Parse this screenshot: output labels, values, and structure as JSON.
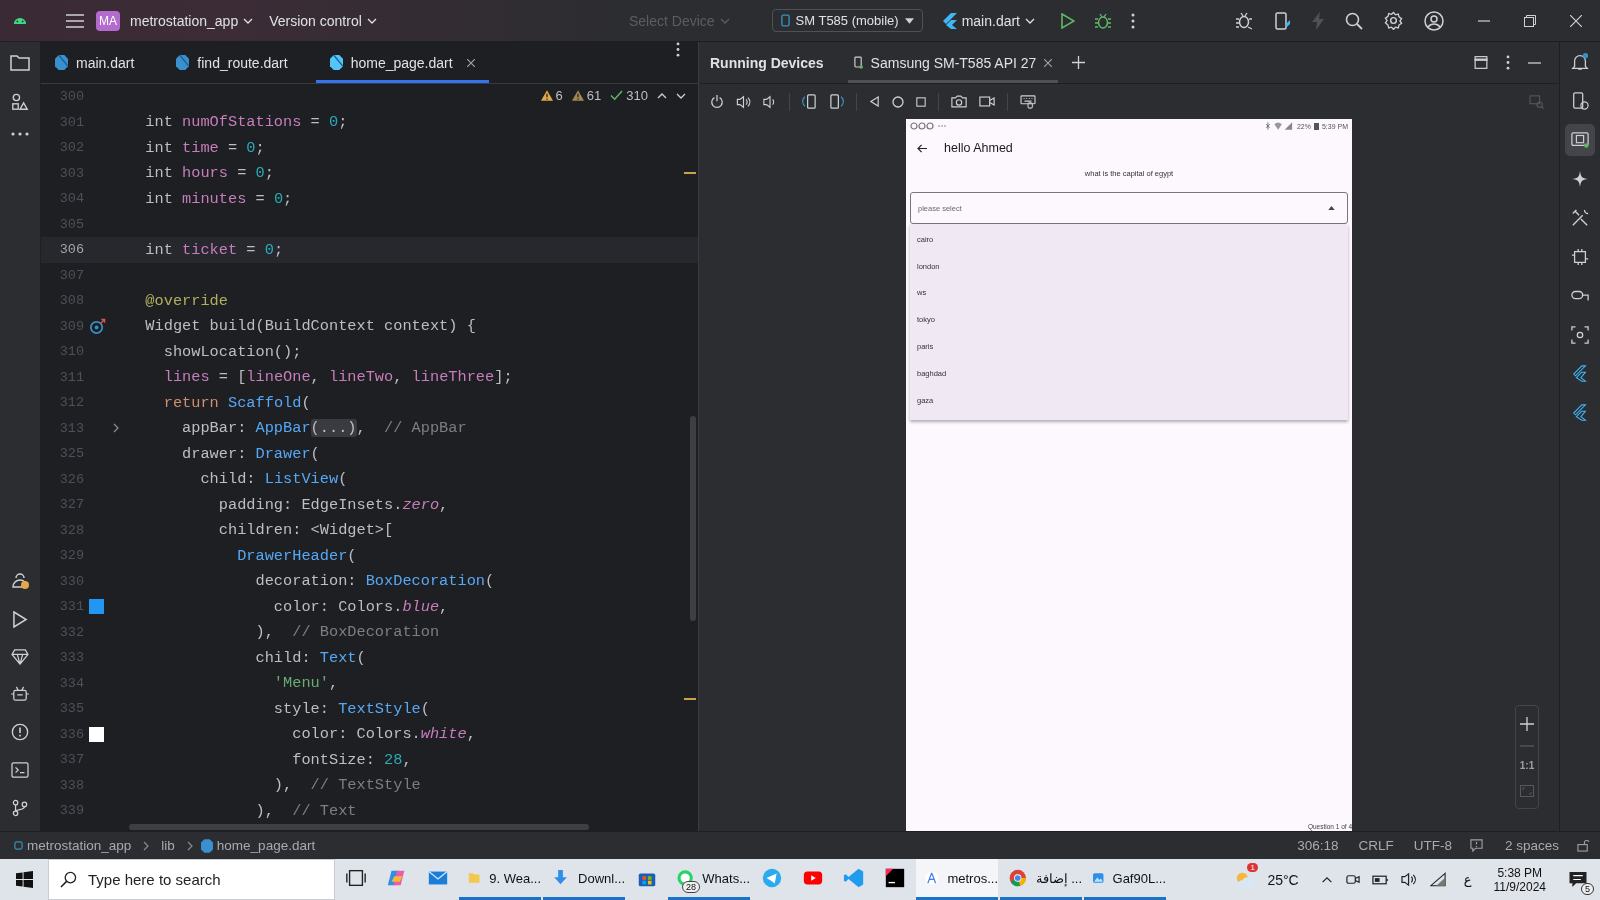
{
  "toolbar": {
    "project_badge": "MA",
    "project": "metrostation_app",
    "vcs": "Version control",
    "device_picker": {
      "label": "Select Device",
      "disabled": true
    },
    "device": "SM T585 (mobile)",
    "run_config": "main.dart"
  },
  "editor_tabs": [
    {
      "label": "main.dart",
      "selected": false
    },
    {
      "label": "find_route.dart",
      "selected": false
    },
    {
      "label": "home_page.dart",
      "selected": true
    }
  ],
  "inspections": {
    "warnings": "6",
    "weak_warnings": "61",
    "ok": "310"
  },
  "code": [
    {
      "num": "300",
      "current": false
    },
    {
      "num": "301",
      "current": false,
      "tokens": [
        {
          "text": "  int ",
          "kind": "plain"
        },
        {
          "text": "numOfStations",
          "kind": "var"
        },
        {
          "text": " = ",
          "kind": "plain"
        },
        {
          "text": "0",
          "kind": "num"
        },
        {
          "text": ";",
          "kind": "plain"
        }
      ]
    },
    {
      "num": "302",
      "current": false,
      "tokens": [
        {
          "text": "  int ",
          "kind": "plain"
        },
        {
          "text": "time",
          "kind": "var"
        },
        {
          "text": " = ",
          "kind": "plain"
        },
        {
          "text": "0",
          "kind": "num"
        },
        {
          "text": ";",
          "kind": "plain"
        }
      ]
    },
    {
      "num": "303",
      "current": false,
      "tokens": [
        {
          "text": "  int ",
          "kind": "plain"
        },
        {
          "text": "hours",
          "kind": "var"
        },
        {
          "text": " = ",
          "kind": "plain"
        },
        {
          "text": "0",
          "kind": "num"
        },
        {
          "text": ";",
          "kind": "plain"
        }
      ]
    },
    {
      "num": "304",
      "current": false,
      "tokens": [
        {
          "text": "  int ",
          "kind": "plain"
        },
        {
          "text": "minutes",
          "kind": "var"
        },
        {
          "text": " = ",
          "kind": "plain"
        },
        {
          "text": "0",
          "kind": "num"
        },
        {
          "text": ";",
          "kind": "plain"
        }
      ]
    },
    {
      "num": "305",
      "current": false
    },
    {
      "num": "306",
      "current": true,
      "tokens": [
        {
          "text": "  int ",
          "kind": "plain"
        },
        {
          "text": "ticket",
          "kind": "var"
        },
        {
          "text": " = ",
          "kind": "plain"
        },
        {
          "text": "0",
          "kind": "num"
        },
        {
          "text": ";",
          "kind": "plain"
        }
      ]
    },
    {
      "num": "307",
      "current": false
    },
    {
      "num": "308",
      "current": false,
      "tokens": [
        {
          "text": "  @override",
          "kind": "ann"
        }
      ]
    },
    {
      "num": "309",
      "current": false,
      "gutter": {
        "kind": "override"
      },
      "tokens": [
        {
          "text": "  Widget build(BuildContext context) {",
          "kind": "plain"
        }
      ]
    },
    {
      "num": "310",
      "current": false,
      "tokens": [
        {
          "text": "    showLocation();",
          "kind": "plain"
        }
      ]
    },
    {
      "num": "311",
      "current": false,
      "tokens": [
        {
          "text": "    lines",
          "kind": "var"
        },
        {
          "text": " = [",
          "kind": "plain"
        },
        {
          "text": "lineOne",
          "kind": "var"
        },
        {
          "text": ", ",
          "kind": "plain"
        },
        {
          "text": "lineTwo",
          "kind": "var"
        },
        {
          "text": ", ",
          "kind": "plain"
        },
        {
          "text": "lineThree",
          "kind": "var"
        },
        {
          "text": "];",
          "kind": "plain"
        }
      ]
    },
    {
      "num": "312",
      "current": false,
      "tokens": [
        {
          "text": "    return ",
          "kind": "kw"
        },
        {
          "text": "Scaffold",
          "kind": "type"
        },
        {
          "text": "(",
          "kind": "plain"
        }
      ]
    },
    {
      "num": "313",
      "current": false,
      "gutter": {
        "kind": "fold"
      },
      "tokens": [
        {
          "text": "      appBar: ",
          "kind": "plain"
        },
        {
          "text": "AppBar",
          "kind": "type"
        },
        {
          "text": "(...)",
          "kind": "fold"
        },
        {
          "text": ",  ",
          "kind": "plain"
        },
        {
          "text": "// AppBar",
          "kind": "cmt"
        }
      ]
    },
    {
      "num": "325",
      "current": false,
      "tokens": [
        {
          "text": "      drawer: ",
          "kind": "plain"
        },
        {
          "text": "Drawer",
          "kind": "type"
        },
        {
          "text": "(",
          "kind": "plain"
        }
      ]
    },
    {
      "num": "326",
      "current": false,
      "tokens": [
        {
          "text": "        child: ",
          "kind": "plain"
        },
        {
          "text": "ListView",
          "kind": "type"
        },
        {
          "text": "(",
          "kind": "plain"
        }
      ]
    },
    {
      "num": "327",
      "current": false,
      "tokens": [
        {
          "text": "          padding: EdgeInsets.",
          "kind": "plain"
        },
        {
          "text": "zero",
          "kind": "ital"
        },
        {
          "text": ",",
          "kind": "plain"
        }
      ]
    },
    {
      "num": "328",
      "current": false,
      "tokens": [
        {
          "text": "          children: <Widget>[",
          "kind": "plain"
        }
      ]
    },
    {
      "num": "329",
      "current": false,
      "tokens": [
        {
          "text": "            DrawerHeader",
          "kind": "type"
        },
        {
          "text": "(",
          "kind": "plain"
        }
      ]
    },
    {
      "num": "330",
      "current": false,
      "tokens": [
        {
          "text": "              decoration: ",
          "kind": "plain"
        },
        {
          "text": "BoxDecoration",
          "kind": "type"
        },
        {
          "text": "(",
          "kind": "plain"
        }
      ]
    },
    {
      "num": "331",
      "current": false,
      "gutter": {
        "kind": "swatch",
        "color": "#2196f3"
      },
      "tokens": [
        {
          "text": "                color: Colors.",
          "kind": "plain"
        },
        {
          "text": "blue",
          "kind": "ital"
        },
        {
          "text": ",",
          "kind": "plain"
        }
      ]
    },
    {
      "num": "332",
      "current": false,
      "tokens": [
        {
          "text": "              ),  ",
          "kind": "plain"
        },
        {
          "text": "// BoxDecoration",
          "kind": "cmt"
        }
      ]
    },
    {
      "num": "333",
      "current": false,
      "tokens": [
        {
          "text": "              child: ",
          "kind": "plain"
        },
        {
          "text": "Text",
          "kind": "type"
        },
        {
          "text": "(",
          "kind": "plain"
        }
      ]
    },
    {
      "num": "334",
      "current": false,
      "tokens": [
        {
          "text": "                'Menu'",
          "kind": "str"
        },
        {
          "text": ",",
          "kind": "plain"
        }
      ]
    },
    {
      "num": "335",
      "current": false,
      "tokens": [
        {
          "text": "                style: ",
          "kind": "plain"
        },
        {
          "text": "TextStyle",
          "kind": "type"
        },
        {
          "text": "(",
          "kind": "plain"
        }
      ]
    },
    {
      "num": "336",
      "current": false,
      "gutter": {
        "kind": "swatch",
        "color": "#ffffff"
      },
      "tokens": [
        {
          "text": "                  color: Colors.",
          "kind": "plain"
        },
        {
          "text": "white",
          "kind": "ital"
        },
        {
          "text": ",",
          "kind": "plain"
        }
      ]
    },
    {
      "num": "337",
      "current": false,
      "tokens": [
        {
          "text": "                  fontSize: ",
          "kind": "plain"
        },
        {
          "text": "28",
          "kind": "num"
        },
        {
          "text": ",",
          "kind": "plain"
        }
      ]
    },
    {
      "num": "338",
      "current": false,
      "tokens": [
        {
          "text": "                ),  ",
          "kind": "plain"
        },
        {
          "text": "// TextStyle",
          "kind": "cmt"
        }
      ]
    },
    {
      "num": "339",
      "current": false,
      "tokens": [
        {
          "text": "              ),  ",
          "kind": "plain"
        },
        {
          "text": "// Text",
          "kind": "cmt"
        }
      ]
    }
  ],
  "devices_panel": {
    "title": "Running Devices",
    "tabs": [
      {
        "label": "Samsung SM-T585 API 27",
        "selected": true
      }
    ]
  },
  "phone": {
    "battery": "22%",
    "time": "5:39 PM",
    "title": "hello Ahmed",
    "question": "what is the capital of egypt",
    "dropdown": {
      "hint": "please select",
      "expanded": true,
      "options": [
        "cairo",
        "london",
        "ws",
        "tokyo",
        "paris",
        "baghdad",
        "gaza"
      ]
    },
    "footer": "Question 1 of 4"
  },
  "zoom": {
    "reset": "1:1"
  },
  "right_tools": [
    {
      "kind": "bell",
      "selected": false
    },
    {
      "kind": "device",
      "selected": false
    },
    {
      "kind": "running",
      "selected": true
    },
    {
      "kind": "sparkle",
      "selected": false
    },
    {
      "kind": "tools",
      "selected": false
    },
    {
      "kind": "emulator",
      "selected": false
    },
    {
      "kind": "link",
      "selected": false
    },
    {
      "kind": "capture",
      "selected": false
    },
    {
      "kind": "flutter",
      "selected": false
    },
    {
      "kind": "flutter",
      "selected": false
    }
  ],
  "status_bar": {
    "breadcrumbs": [
      "metrostation_app",
      "lib",
      "home_page.dart"
    ],
    "position": "306:18",
    "line_separator": "CRLF",
    "encoding": "UTF-8",
    "indent": "2 spaces"
  },
  "taskbar": {
    "search": {
      "placeholder": "Type here to search"
    },
    "apps": [
      {
        "kind": "taskview",
        "open": false,
        "active": false
      },
      {
        "kind": "copilot",
        "open": false,
        "active": false
      },
      {
        "kind": "mail",
        "open": false,
        "active": false
      },
      {
        "kind": "folder",
        "label": "9. Wea...",
        "open": true,
        "active": false
      },
      {
        "kind": "download",
        "label": "Downl...",
        "open": true,
        "active": false
      },
      {
        "kind": "store",
        "open": false,
        "active": false
      },
      {
        "kind": "whatsapp",
        "label": "Whats...",
        "badge": "28",
        "open": true,
        "active": false
      },
      {
        "kind": "telegram",
        "open": false,
        "active": false
      },
      {
        "kind": "youtube",
        "open": false,
        "active": false
      },
      {
        "kind": "vscode",
        "open": false,
        "active": false
      },
      {
        "kind": "intellij",
        "open": false,
        "active": false
      },
      {
        "kind": "studio",
        "label": "metros...",
        "open": true,
        "active": true
      },
      {
        "kind": "chrome",
        "label": "إضافة ...",
        "open": true,
        "active": false
      },
      {
        "kind": "photos",
        "label": "Gaf90L...",
        "open": true,
        "active": false
      }
    ],
    "weather": {
      "temp": "25°C",
      "badge": "1"
    },
    "language": "ع",
    "time": "5:38 PM",
    "date": "11/9/2024",
    "notifications": "5"
  }
}
